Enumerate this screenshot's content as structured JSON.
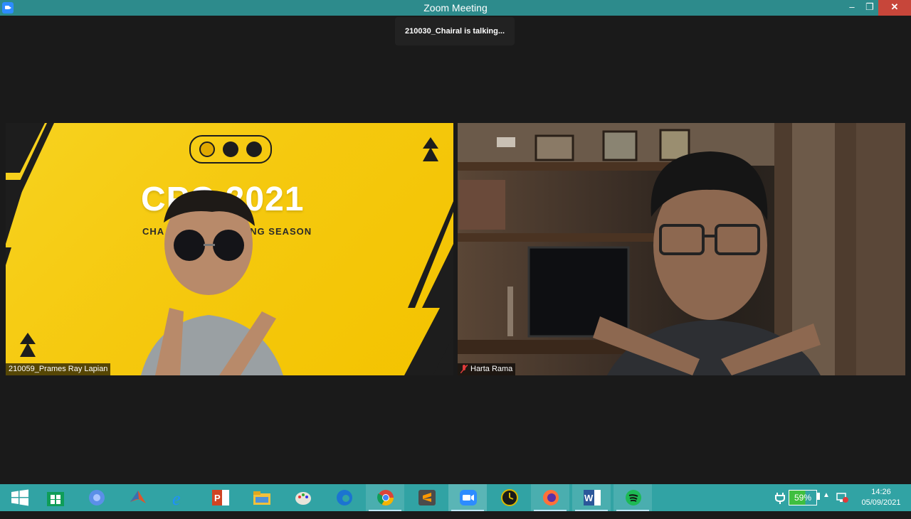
{
  "window": {
    "title": "Zoom Meeting",
    "minimize": "–",
    "restore": "❐",
    "close": "✕"
  },
  "notification": {
    "talking": "210030_Chairal is talking..."
  },
  "participants": [
    {
      "name": "210059_Prames Ray Lapian",
      "background_title": "CPC 2021",
      "background_subtitle": "CHA",
      "background_subtitle_end": "NG SEASON",
      "muted": false
    },
    {
      "name": "Harta Rama",
      "muted": true
    }
  ],
  "taskbar": {
    "apps": [
      "start-icon",
      "store-icon",
      "chromium-icon",
      "matlab-icon",
      "ie-icon",
      "powerpoint-icon",
      "file-explorer-icon",
      "paint-icon",
      "edge-icon",
      "chrome-icon",
      "sublime-icon",
      "zoom-icon",
      "clock-app-icon",
      "firefox-icon",
      "word-icon",
      "spotify-icon"
    ],
    "active_app": "zoom-icon",
    "tray": {
      "battery_percent": "59%",
      "time": "14:26",
      "date": "05/09/2021"
    }
  },
  "colors": {
    "titlebar": "#2d8b8c",
    "taskbar": "#31a3a4",
    "close": "#c7463a",
    "yellow_bg": "#f5c90f"
  }
}
